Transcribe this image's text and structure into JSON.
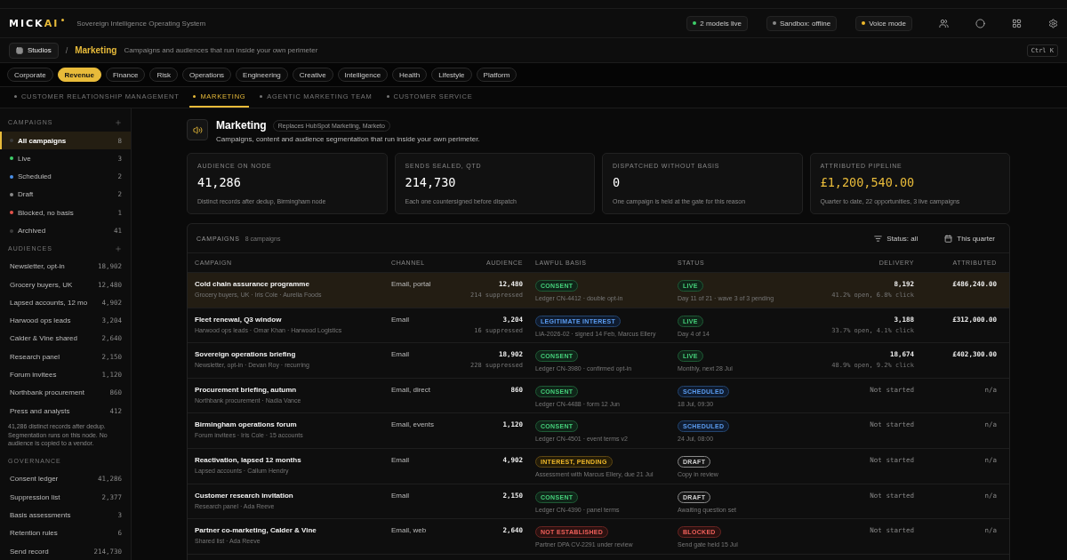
{
  "header": {
    "logo": {
      "text": "MICK",
      "accent": "AI"
    },
    "tagline": "Sovereign Intelligence Operating System",
    "chips": [
      {
        "label": "2 models live",
        "color": "#3ecf6a"
      },
      {
        "label": "Sandbox: offline",
        "color": "#8a8a8a"
      },
      {
        "label": "Voice mode",
        "color": "#f0b92a"
      }
    ]
  },
  "breadcrumb": {
    "root": "Studios",
    "separator": "/",
    "current": "Marketing",
    "description": "Campaigns and audiences that run inside your own perimeter",
    "shortcut": "Ctrl K"
  },
  "categories": [
    {
      "label": "Corporate",
      "selected": false
    },
    {
      "label": "Revenue",
      "selected": true
    },
    {
      "label": "Finance",
      "selected": false
    },
    {
      "label": "Risk",
      "selected": false
    },
    {
      "label": "Operations",
      "selected": false
    },
    {
      "label": "Engineering",
      "selected": false
    },
    {
      "label": "Creative",
      "selected": false
    },
    {
      "label": "Intelligence",
      "selected": false
    },
    {
      "label": "Health",
      "selected": false
    },
    {
      "label": "Lifestyle",
      "selected": false
    },
    {
      "label": "Platform",
      "selected": false
    }
  ],
  "subtabs": [
    {
      "label": "CUSTOMER RELATIONSHIP MANAGEMENT",
      "selected": false
    },
    {
      "label": "MARKETING",
      "selected": true
    },
    {
      "label": "AGENTIC MARKETING TEAM",
      "selected": false
    },
    {
      "label": "CUSTOMER SERVICE",
      "selected": false
    }
  ],
  "sidebar": {
    "campaigns": {
      "title": "CAMPAIGNS",
      "items": [
        {
          "label": "All campaigns",
          "count": "8",
          "color": "#3a3a3a",
          "selected": true
        },
        {
          "label": "Live",
          "count": "3",
          "color": "#3ecf6a",
          "selected": false
        },
        {
          "label": "Scheduled",
          "count": "2",
          "color": "#4a8fe8",
          "selected": false
        },
        {
          "label": "Draft",
          "count": "2",
          "color": "#8a8a8a",
          "selected": false
        },
        {
          "label": "Blocked, no basis",
          "count": "1",
          "color": "#e5534b",
          "selected": false
        },
        {
          "label": "Archived",
          "count": "41",
          "color": "#3a3a3a",
          "selected": false
        }
      ]
    },
    "audiences": {
      "title": "AUDIENCES",
      "items": [
        {
          "label": "Newsletter, opt-in",
          "count": "18,902"
        },
        {
          "label": "Grocery buyers, UK",
          "count": "12,480"
        },
        {
          "label": "Lapsed accounts, 12 mo",
          "count": "4,902"
        },
        {
          "label": "Harwood ops leads",
          "count": "3,204"
        },
        {
          "label": "Calder & Vine shared",
          "count": "2,640"
        },
        {
          "label": "Research panel",
          "count": "2,150"
        },
        {
          "label": "Forum invitees",
          "count": "1,120"
        },
        {
          "label": "Northbank procurement",
          "count": "860"
        },
        {
          "label": "Press and analysts",
          "count": "412"
        }
      ],
      "note": "41,286 distinct records after dedup. Segmentation runs on this node. No audience is copied to a vendor."
    },
    "governance": {
      "title": "GOVERNANCE",
      "items": [
        {
          "label": "Consent ledger",
          "count": "41,286"
        },
        {
          "label": "Suppression list",
          "count": "2,377"
        },
        {
          "label": "Basis assessments",
          "count": "3"
        },
        {
          "label": "Retention rules",
          "count": "6"
        },
        {
          "label": "Send record",
          "count": "214,730"
        }
      ]
    }
  },
  "page": {
    "title": "Marketing",
    "replaces": "Replaces HubSpot Marketing, Marketo",
    "subtitle": "Campaigns, content and audience segmentation that run inside your own perimeter."
  },
  "stats": [
    {
      "label": "AUDIENCE ON NODE",
      "value": "41,286",
      "note": "Distinct records after dedup, Birmingham node",
      "highlight": false
    },
    {
      "label": "SENDS SEALED, QTD",
      "value": "214,730",
      "note": "Each one countersigned before dispatch",
      "highlight": false
    },
    {
      "label": "DISPATCHED WITHOUT BASIS",
      "value": "0",
      "note": "One campaign is held at the gate for this reason",
      "highlight": false
    },
    {
      "label": "ATTRIBUTED PIPELINE",
      "value": "£1,200,540.00",
      "note": "Quarter to date, 22 opportunities, 3 live campaigns",
      "highlight": true
    }
  ],
  "table": {
    "title": "CAMPAIGNS",
    "count": "8 campaigns",
    "filter": "Status: all",
    "period": "This quarter",
    "columns": [
      "CAMPAIGN",
      "CHANNEL",
      "AUDIENCE",
      "LAWFUL BASIS",
      "STATUS",
      "DELIVERY",
      "ATTRIBUTED"
    ],
    "rows": [
      {
        "selected": true,
        "name": "Cold chain assurance programme",
        "meta": "Grocery buyers, UK · Iris Cole · Aurelia Foods",
        "channel": "Email, portal",
        "audience": "12,480",
        "suppressed": "214 suppressed",
        "basis": {
          "label": "CONSENT",
          "kind": "positive"
        },
        "basis_note": "Ledger CN-4412 · double opt-in",
        "status": {
          "label": "LIVE",
          "kind": "positive"
        },
        "status_note": "Day 11 of 21 · wave 3 of 3 pending",
        "delivery": "8,192",
        "delivery_note": "41.2% open, 6.8% click",
        "attributed": "£486,240.00"
      },
      {
        "selected": false,
        "name": "Fleet renewal, Q3 window",
        "meta": "Harwood ops leads · Omar Khan · Harwood Logistics",
        "channel": "Email",
        "audience": "3,204",
        "suppressed": "16 suppressed",
        "basis": {
          "label": "LEGITIMATE INTEREST",
          "kind": "info"
        },
        "basis_note": "LIA-2026-02 · signed 14 Feb, Marcus Ellery",
        "status": {
          "label": "LIVE",
          "kind": "positive"
        },
        "status_note": "Day 4 of 14",
        "delivery": "3,188",
        "delivery_note": "33.7% open, 4.1% click",
        "attributed": "£312,000.00"
      },
      {
        "selected": false,
        "name": "Sovereign operations briefing",
        "meta": "Newsletter, opt-in · Devan Roy · recurring",
        "channel": "Email",
        "audience": "18,902",
        "suppressed": "228 suppressed",
        "basis": {
          "label": "CONSENT",
          "kind": "positive"
        },
        "basis_note": "Ledger CN-3980 · confirmed opt-in",
        "status": {
          "label": "LIVE",
          "kind": "positive"
        },
        "status_note": "Monthly, next 28 Jul",
        "delivery": "18,674",
        "delivery_note": "48.9% open, 9.2% click",
        "attributed": "£402,300.00"
      },
      {
        "selected": false,
        "name": "Procurement briefing, autumn",
        "meta": "Northbank procurement · Nadia Vance",
        "channel": "Email, direct",
        "audience": "860",
        "basis": {
          "label": "CONSENT",
          "kind": "positive"
        },
        "basis_note": "Ledger CN-4488 · form 12 Jun",
        "status": {
          "label": "SCHEDULED",
          "kind": "info"
        },
        "status_note": "18 Jul, 09:30",
        "delivery": "Not started",
        "attributed": "n/a"
      },
      {
        "selected": false,
        "name": "Birmingham operations forum",
        "meta": "Forum invitees · Iris Cole · 15 accounts",
        "channel": "Email, events",
        "audience": "1,120",
        "basis": {
          "label": "CONSENT",
          "kind": "positive"
        },
        "basis_note": "Ledger CN-4501 · event terms v2",
        "status": {
          "label": "SCHEDULED",
          "kind": "info"
        },
        "status_note": "24 Jul, 08:00",
        "delivery": "Not started",
        "attributed": "n/a"
      },
      {
        "selected": false,
        "name": "Reactivation, lapsed 12 months",
        "meta": "Lapsed accounts · Callum Hendry",
        "channel": "Email",
        "audience": "4,902",
        "basis": {
          "label": "INTEREST, PENDING",
          "kind": "warning"
        },
        "basis_note": "Assessment with Marcus Ellery, due 21 Jul",
        "status": {
          "label": "DRAFT",
          "kind": "neutral"
        },
        "status_note": "Copy in review",
        "delivery": "Not started",
        "attributed": "n/a"
      },
      {
        "selected": false,
        "name": "Customer research invitation",
        "meta": "Research panel · Ada Reeve",
        "channel": "Email",
        "audience": "2,150",
        "basis": {
          "label": "CONSENT",
          "kind": "positive"
        },
        "basis_note": "Ledger CN-4390 · panel terms",
        "status": {
          "label": "DRAFT",
          "kind": "neutral"
        },
        "status_note": "Awaiting question set",
        "delivery": "Not started",
        "attributed": "n/a"
      },
      {
        "selected": false,
        "name": "Partner co-marketing, Calder & Vine",
        "meta": "Shared list · Ada Reeve",
        "channel": "Email, web",
        "audience": "2,640",
        "basis": {
          "label": "NOT ESTABLISHED",
          "kind": "danger"
        },
        "basis_note": "Partner DPA CV-2291 under review",
        "status": {
          "label": "BLOCKED",
          "kind": "danger"
        },
        "status_note": "Send gate held 15 Jul",
        "delivery": "Not started",
        "attributed": "n/a"
      }
    ]
  }
}
